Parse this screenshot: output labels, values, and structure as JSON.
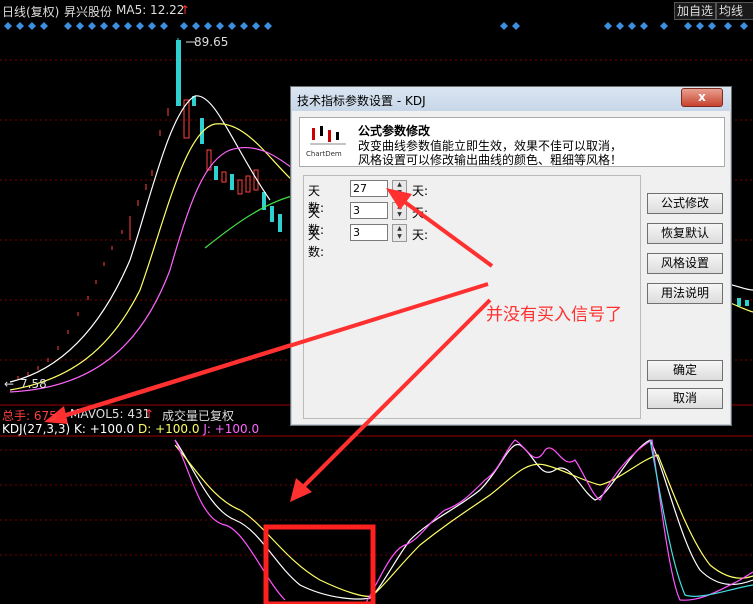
{
  "header": {
    "period_label": "日线(复权)",
    "stock_name": "昇兴股份",
    "ma_label": "MA5: 12.22",
    "ma_arrow": "↑",
    "add_watch": "加自选",
    "ma_button": "均线"
  },
  "price_chart": {
    "high_label": "89.65",
    "low_label": "7.58"
  },
  "volume_panel": {
    "total_label": "总手: 675",
    "mavol_label": "MAVOL5: 431",
    "mavol_arrow": "↑",
    "volume_mode": "成交量已复权"
  },
  "kdj_panel": {
    "name": "KDJ(27,3,3)",
    "k_label": "K: +100.0",
    "d_label": "D: +100.0",
    "j_label": "J: +100.0",
    "colors": {
      "k": "#ffffff",
      "d": "#ffff55",
      "j": "#ff55ff"
    }
  },
  "dialog": {
    "title": "技术指标参数设置 - KDJ",
    "close_label": "x",
    "banner_heading": "公式参数修改",
    "banner_line1": "改变曲线参数值能立即生效，效果不佳可以取消，",
    "banner_line2": "风格设置可以修改输出曲线的颜色、粗细等风格！",
    "logo_caption": "ChartDem",
    "params": [
      {
        "label": "天数:",
        "value": "27",
        "unit": "天:"
      },
      {
        "label": "天数:",
        "value": "3",
        "unit": "天:"
      },
      {
        "label": "天数:",
        "value": "3",
        "unit": "天:"
      }
    ],
    "buttons": {
      "formula_edit": "公式修改",
      "restore_default": "恢复默认",
      "style_settings": "风格设置",
      "usage_help": "用法说明",
      "ok": "确定",
      "cancel": "取消"
    }
  },
  "annotation": {
    "text": "并没有买入信号了",
    "color": "#ff3030"
  }
}
